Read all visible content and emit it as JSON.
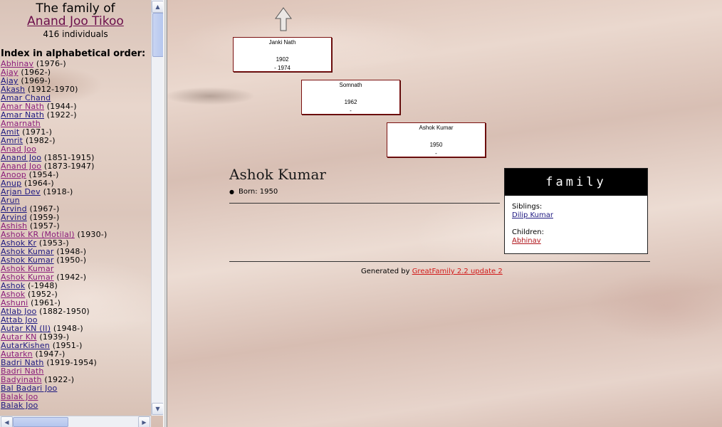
{
  "sidebar": {
    "title": "The family of",
    "family_name": "Anand Joo Tikoo",
    "count": "416 individuals",
    "index_heading": "Index in alphabetical order:",
    "entries": [
      {
        "name": "Abhinav",
        "dates": "(1976-)",
        "color": "purple"
      },
      {
        "name": "Ajay",
        "dates": "(1962-)",
        "color": "purple"
      },
      {
        "name": "Ajay",
        "dates": "(1969-)",
        "color": "blue"
      },
      {
        "name": "Akash",
        "dates": "(1912-1970)",
        "color": "blue"
      },
      {
        "name": "Amar Chand",
        "dates": "",
        "color": "blue"
      },
      {
        "name": "Amar Nath",
        "dates": "(1944-)",
        "color": "purple"
      },
      {
        "name": "Amar Nath",
        "dates": "(1922-)",
        "color": "blue"
      },
      {
        "name": "Amarnath",
        "dates": "",
        "color": "purple"
      },
      {
        "name": "Amit",
        "dates": "(1971-)",
        "color": "blue"
      },
      {
        "name": "Amrit",
        "dates": "(1982-)",
        "color": "blue"
      },
      {
        "name": "Anad Joo",
        "dates": "",
        "color": "purple"
      },
      {
        "name": "Anand Joo",
        "dates": "(1851-1915)",
        "color": "blue"
      },
      {
        "name": "Anand Joo",
        "dates": "(1873-1947)",
        "color": "purple"
      },
      {
        "name": "Anoop",
        "dates": "(1954-)",
        "color": "purple"
      },
      {
        "name": "Anup",
        "dates": "(1964-)",
        "color": "blue"
      },
      {
        "name": "Arjan Dev",
        "dates": "(1918-)",
        "color": "blue"
      },
      {
        "name": "Arun",
        "dates": "",
        "color": "blue"
      },
      {
        "name": "Arvind",
        "dates": "(1967-)",
        "color": "blue"
      },
      {
        "name": "Arvind",
        "dates": "(1959-)",
        "color": "blue"
      },
      {
        "name": "Ashish",
        "dates": "(1957-)",
        "color": "purple"
      },
      {
        "name": "Ashok KR (Motilal)",
        "dates": "(1930-)",
        "color": "purple"
      },
      {
        "name": "Ashok Kr",
        "dates": "(1953-)",
        "color": "blue"
      },
      {
        "name": "Ashok Kumar",
        "dates": "(1948-)",
        "color": "blue"
      },
      {
        "name": "Ashok Kumar",
        "dates": "(1950-)",
        "color": "blue"
      },
      {
        "name": "Ashok Kumar",
        "dates": "",
        "color": "purple"
      },
      {
        "name": "Ashok Kumar",
        "dates": "(1942-)",
        "color": "purple"
      },
      {
        "name": "Ashok",
        "dates": "(-1948)",
        "color": "blue"
      },
      {
        "name": "Ashok",
        "dates": "(1952-)",
        "color": "purple"
      },
      {
        "name": "Ashuni",
        "dates": "(1961-)",
        "color": "purple"
      },
      {
        "name": "Atlab Joo",
        "dates": "(1882-1950)",
        "color": "blue"
      },
      {
        "name": "Attab Joo",
        "dates": "",
        "color": "blue"
      },
      {
        "name": "Autar KN (II)",
        "dates": "(1948-)",
        "color": "blue"
      },
      {
        "name": "Autar KN",
        "dates": "(1939-)",
        "color": "purple"
      },
      {
        "name": "AutarKishen",
        "dates": "(1951-)",
        "color": "blue"
      },
      {
        "name": "Autarkn",
        "dates": "(1947-)",
        "color": "purple"
      },
      {
        "name": "Badri Nath",
        "dates": "(1919-1954)",
        "color": "blue"
      },
      {
        "name": "Badri Nath",
        "dates": "",
        "color": "purple"
      },
      {
        "name": "Badyinath",
        "dates": "(1922-)",
        "color": "purple"
      },
      {
        "name": "Bal Badari Joo",
        "dates": "",
        "color": "blue"
      },
      {
        "name": "Balak Joo",
        "dates": "",
        "color": "purple"
      },
      {
        "name": "Balak Joo",
        "dates": "",
        "color": "blue"
      }
    ]
  },
  "tree": [
    {
      "name": "Janki Nath",
      "born": "1902",
      "died": "- 1974"
    },
    {
      "name": "Somnath",
      "born": "1962",
      "died": "-"
    },
    {
      "name": "Ashok Kumar",
      "born": "1950",
      "died": "-"
    }
  ],
  "person": {
    "name": "Ashok Kumar",
    "born": "Born: 1950"
  },
  "family": {
    "heading": "family",
    "siblings_label": "Siblings:",
    "sibling": "Dilip Kumar",
    "children_label": "Children:",
    "child": "Abhinav"
  },
  "footer": {
    "generated_by": "Generated by",
    "link": "GreatFamily 2.2 update 2"
  },
  "icons": {
    "up": "up-arrow-icon",
    "scroll_up": "chevron-up-icon",
    "scroll_down": "chevron-down-icon",
    "scroll_left": "chevron-left-icon",
    "scroll_right": "chevron-right-icon"
  },
  "colors": {
    "link_blue": "#1d1880",
    "link_purple": "#8a1c7a",
    "tree_border": "#7a1010",
    "footer_link": "#d11a1a"
  }
}
